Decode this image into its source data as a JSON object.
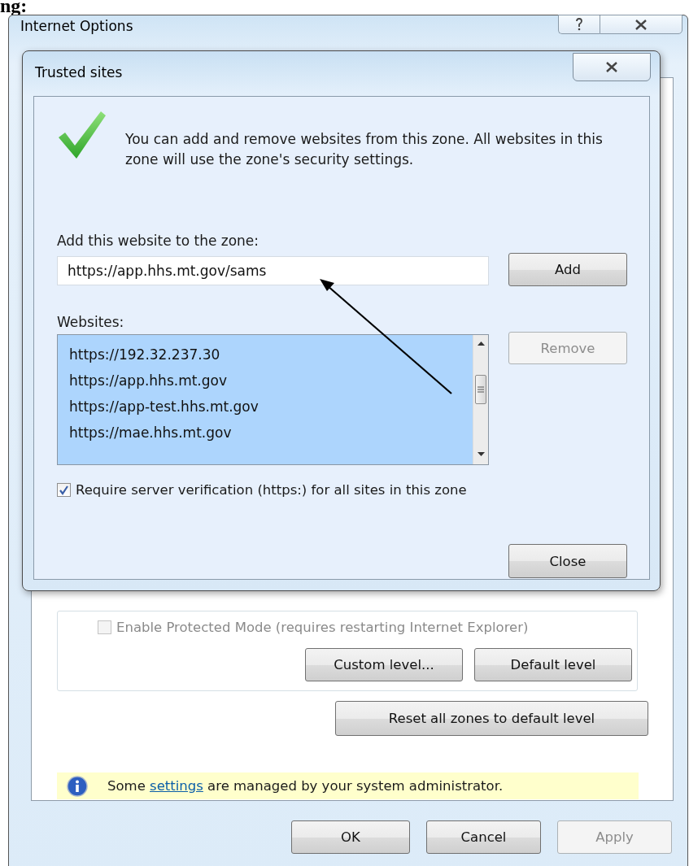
{
  "caption": "ng:",
  "window": {
    "title": "Internet Options"
  },
  "security_tab": {
    "protected_mode": {
      "label": "Enable Protected Mode (requires restarting Internet Explorer)",
      "checked": false,
      "disabled": true
    },
    "level_buttons": [
      {
        "label": "Custom level...",
        "disabled": false
      },
      {
        "label": "Default level",
        "disabled": false
      }
    ],
    "reset_button": {
      "label": "Reset all zones to default level",
      "disabled": false
    },
    "info": {
      "before": "Some",
      "link": "settings",
      "after": "are managed by your system administrator."
    }
  },
  "footer_buttons": [
    {
      "label": "OK",
      "disabled": false
    },
    {
      "label": "Cancel",
      "disabled": false
    },
    {
      "label": "Apply",
      "disabled": true
    }
  ],
  "dialog": {
    "title": "Trusted sites",
    "message": "You can add and remove websites from this zone. All websites in this zone will use the zone's security settings.",
    "add_label": "Add this website to the zone:",
    "add_value": "https://app.hhs.mt.gov/sams",
    "add_button": {
      "label": "Add",
      "disabled": false
    },
    "websites_label": "Websites:",
    "websites": [
      {
        "url": "https://192.32.237.30"
      },
      {
        "url": "https://app.hhs.mt.gov"
      },
      {
        "url": "https://app-test.hhs.mt.gov"
      },
      {
        "url": "https://mae.hhs.mt.gov"
      }
    ],
    "remove_button": {
      "label": "Remove",
      "disabled": true
    },
    "require_https": {
      "label": "Require server verification (https:) for all sites in this zone",
      "checked": true
    },
    "close_button": {
      "label": "Close",
      "disabled": false
    }
  }
}
